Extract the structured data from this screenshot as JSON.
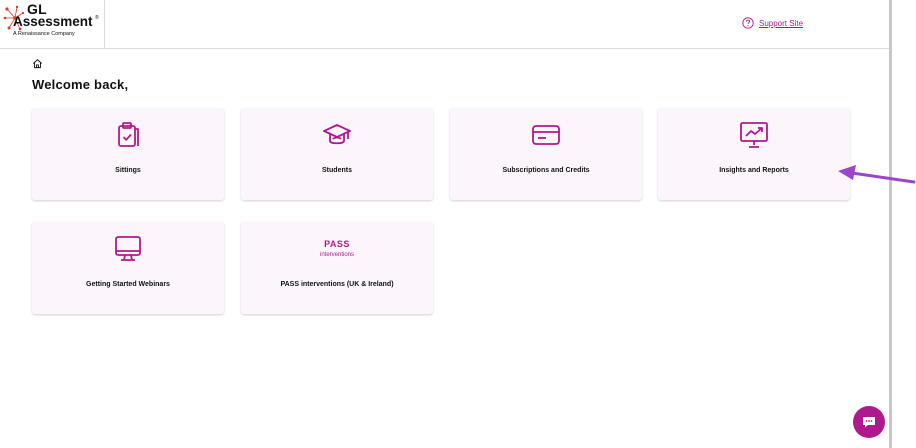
{
  "brand": {
    "name": "GL",
    "name_line2": "Assessment",
    "registered": "®",
    "tagline": "A Renaissance Company",
    "accent": "#b0198d"
  },
  "header": {
    "support_label": "Support Site",
    "support_icon": "help-circle-icon"
  },
  "page": {
    "home_icon": "home-icon",
    "title": "Welcome back,"
  },
  "cards": [
    {
      "label": "Sittings",
      "icon": "clipboard-check-icon"
    },
    {
      "label": "Students",
      "icon": "graduation-cap-icon"
    },
    {
      "label": "Subscriptions and Credits",
      "icon": "credit-card-icon"
    },
    {
      "label": "Insights and Reports",
      "icon": "presentation-chart-icon"
    },
    {
      "label": "Getting Started Webinars",
      "icon": "monitor-icon"
    },
    {
      "label": "PASS interventions (UK & Ireland)",
      "icon": "pass-logo",
      "logo_word": "PASS",
      "logo_sub": "interventions"
    }
  ],
  "annotation": {
    "icon": "arrow-left-icon",
    "color": "#9b45c9"
  },
  "chat": {
    "icon": "chat-bubble-icon"
  }
}
